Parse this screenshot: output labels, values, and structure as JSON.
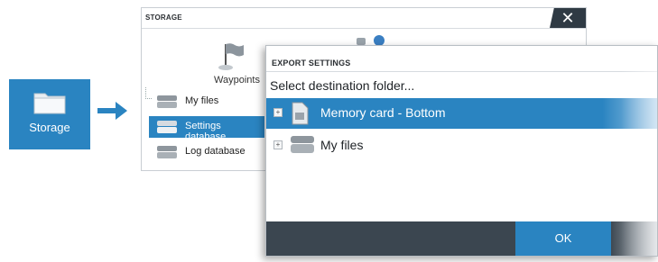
{
  "storage_tile": {
    "label": "Storage",
    "icon": "folder-icon"
  },
  "storage_window": {
    "title": "STORAGE",
    "close_glyph": "✕",
    "waypoints_label": "Waypoints",
    "tree": [
      {
        "label": "My files",
        "icon": "database-icon",
        "selected": false
      },
      {
        "label": "Settings database",
        "icon": "database-icon",
        "selected": true
      },
      {
        "label": "Log database",
        "icon": "database-icon",
        "selected": false
      }
    ]
  },
  "export_dialog": {
    "title": "EXPORT SETTINGS",
    "prompt": "Select destination folder...",
    "rows": [
      {
        "label": "Memory card - Bottom",
        "icon": "memory-card-icon",
        "selected": true,
        "expander": "+"
      },
      {
        "label": "My files",
        "icon": "database-icon",
        "selected": false,
        "expander": "+"
      }
    ],
    "ok_label": "OK"
  },
  "colors": {
    "accent": "#2a84c1",
    "footer": "#3b4650",
    "close_bg": "#2f3a44"
  }
}
